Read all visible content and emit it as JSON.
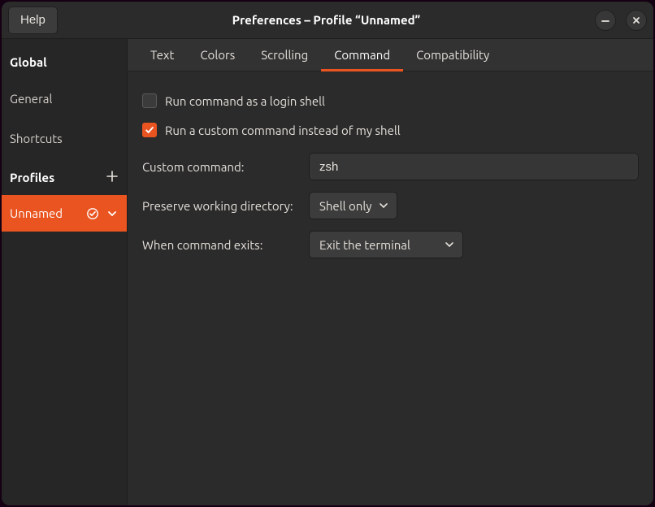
{
  "titlebar": {
    "help_label": "Help",
    "title": "Preferences – Profile “Unnamed”"
  },
  "sidebar": {
    "global_heading": "Global",
    "items": [
      "General",
      "Shortcuts"
    ],
    "profiles_heading": "Profiles",
    "active_profile": "Unnamed"
  },
  "tabs": {
    "items": [
      "Text",
      "Colors",
      "Scrolling",
      "Command",
      "Compatibility"
    ],
    "active_index": 3
  },
  "command": {
    "login_shell_label": "Run command as a login shell",
    "login_shell_checked": false,
    "custom_cmd_label": "Run a custom command instead of my shell",
    "custom_cmd_checked": true,
    "custom_command_label": "Custom command:",
    "custom_command_value": "zsh",
    "preserve_wd_label": "Preserve working directory:",
    "preserve_wd_value": "Shell only",
    "when_exits_label": "When command exits:",
    "when_exits_value": "Exit the terminal"
  },
  "colors": {
    "accent": "#e95420"
  }
}
